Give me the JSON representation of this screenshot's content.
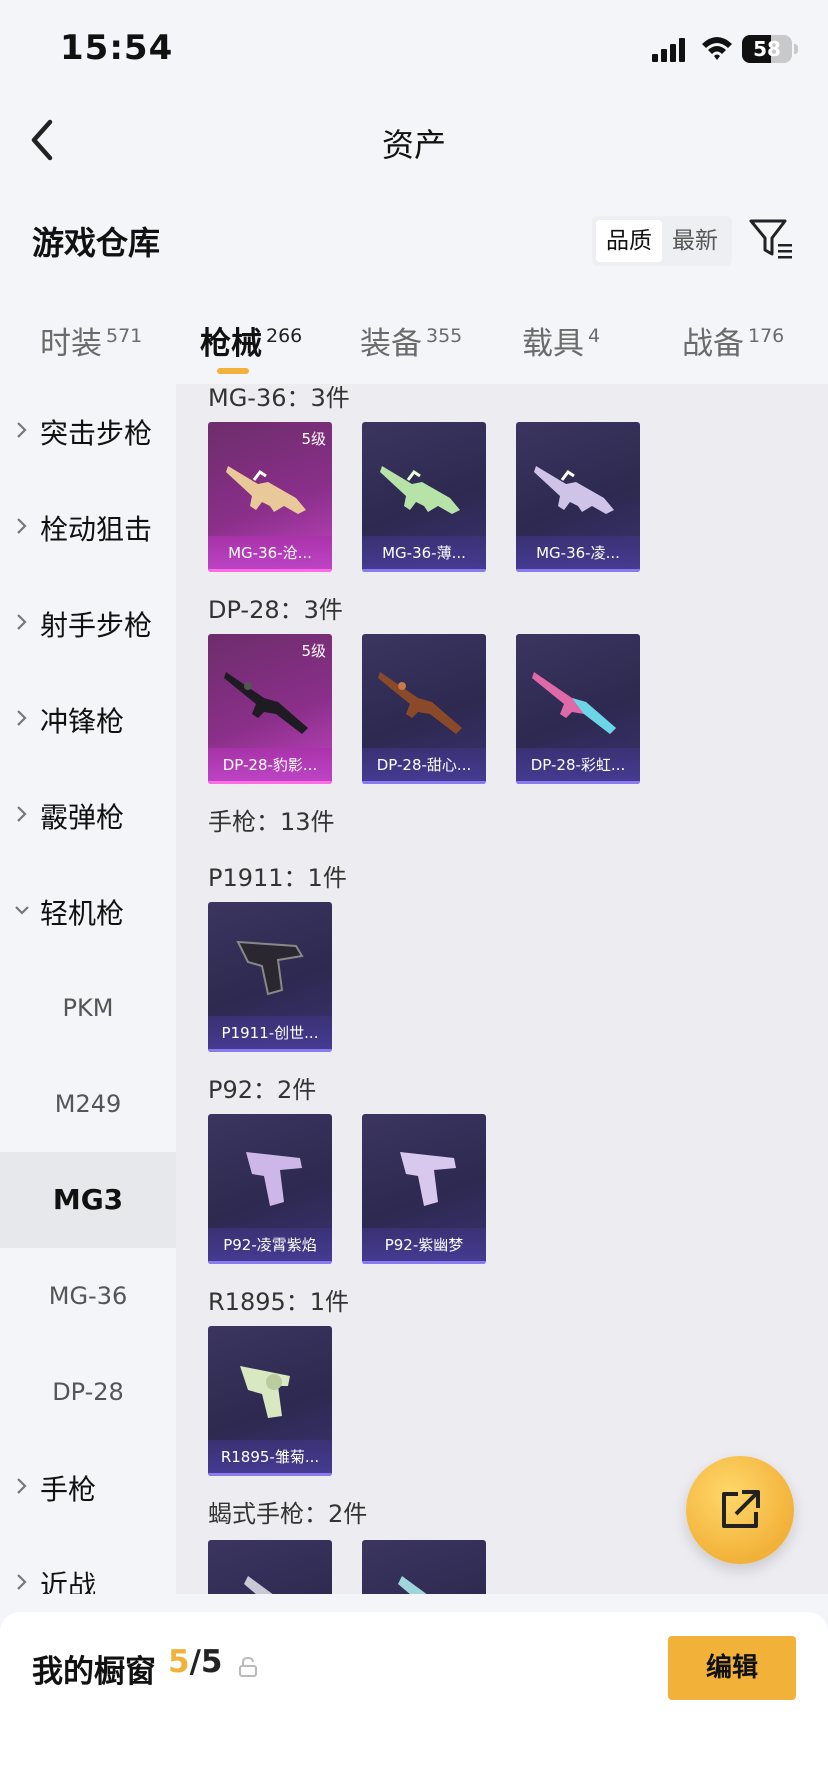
{
  "status": {
    "time": "15:54",
    "battery": "58"
  },
  "nav": {
    "title": "资产"
  },
  "warehouse": {
    "title": "游戏仓库",
    "sort_quality": "品质",
    "sort_newest": "最新"
  },
  "tabs": [
    {
      "label": "时装",
      "count": "571"
    },
    {
      "label": "枪械",
      "count": "266"
    },
    {
      "label": "装备",
      "count": "355"
    },
    {
      "label": "载具",
      "count": "4"
    },
    {
      "label": "战备",
      "count": "176"
    }
  ],
  "sidebar": {
    "items": [
      "突击步枪",
      "栓动狙击",
      "射手步枪",
      "冲锋枪",
      "霰弹枪",
      "轻机枪"
    ],
    "subitems": [
      "PKM",
      "M249",
      "MG3",
      "MG-36",
      "DP-28"
    ],
    "items_after": [
      "手枪",
      "近战"
    ]
  },
  "content": {
    "sections": [
      {
        "title": "MG-36：3件",
        "cards": [
          {
            "name": "MG-36-沧...",
            "level": "5级",
            "tier": "gold"
          },
          {
            "name": "MG-36-薄...",
            "tier": "purple"
          },
          {
            "name": "MG-36-凌...",
            "tier": "purple"
          }
        ]
      },
      {
        "title": "DP-28：3件",
        "cards": [
          {
            "name": "DP-28-豹影...",
            "level": "5级",
            "tier": "gold"
          },
          {
            "name": "DP-28-甜心...",
            "tier": "purple"
          },
          {
            "name": "DP-28-彩虹...",
            "tier": "purple"
          }
        ]
      },
      {
        "title": "手枪：13件"
      },
      {
        "title": "P1911：1件",
        "cards": [
          {
            "name": "P1911-创世...",
            "tier": "purple"
          }
        ]
      },
      {
        "title": "P92：2件",
        "cards": [
          {
            "name": "P92-凌霄紫焰",
            "tier": "purple"
          },
          {
            "name": "P92-紫幽梦",
            "tier": "purple"
          }
        ]
      },
      {
        "title": "R1895：1件",
        "cards": [
          {
            "name": "R1895-雏菊...",
            "tier": "purple"
          }
        ]
      },
      {
        "title": "蝎式手枪：2件"
      }
    ]
  },
  "showcase": {
    "label": "我的橱窗",
    "current": "5",
    "total": "/5",
    "edit_label": "编辑"
  },
  "colors": {
    "accent": "#f2b23a",
    "gold_card": "#c245c2",
    "purple_card": "#2d2950"
  }
}
